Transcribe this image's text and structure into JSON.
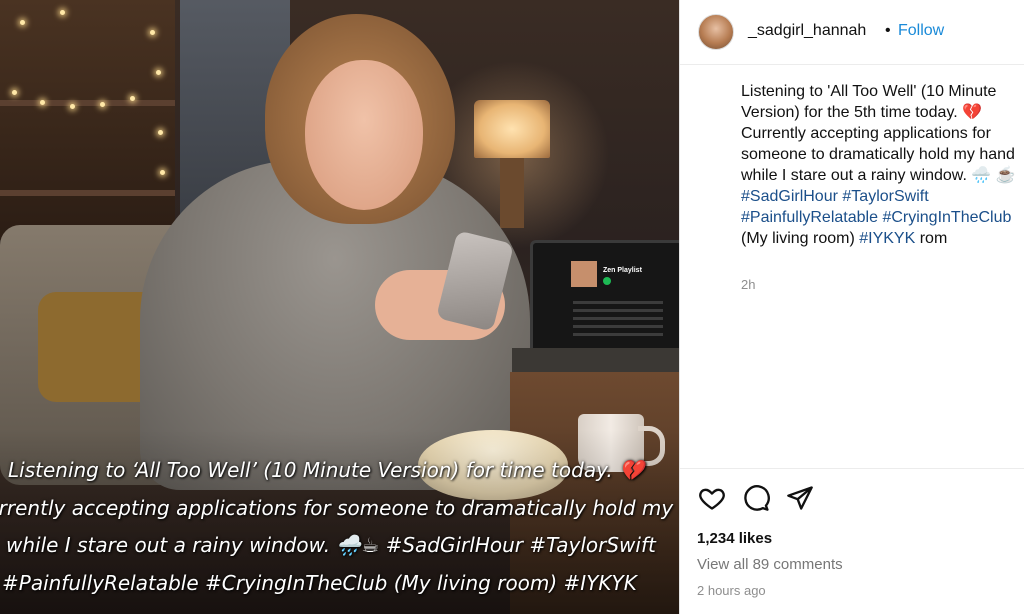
{
  "photo": {
    "laptop_playlist_title": "Zen Playlist",
    "overlay_lines": [
      "Listening to ‘All Too Well’ (10 Minute Version) for time today. 💔",
      "urrently accepting applications for someone to dramatically hold my hand",
      "while I stare out a rainy window. 🌧️☕ #SadGirlHour #TaylorSwift",
      "#PainfullyRelatable #CryingInTheClub (My living room) #IYKYK"
    ]
  },
  "header": {
    "username": "_sadgirl_hannah",
    "separator": "•",
    "follow_label": "Follow"
  },
  "caption": {
    "text_1": "Listening to 'All Too Well' (10 Minute Version) for the 5th time today. 💔 Currently accepting applications for someone to dramatically hold my hand while I stare out a rainy window. 🌧️ ☕ ",
    "tag_1": "#SadGirlHour",
    "tag_2": "#TaylorSwift",
    "tag_3": "#PainfullyRelatable",
    "tag_4": "#CryingInTheClub",
    "text_2": " (My living room) ",
    "tag_5": "#IYKYK",
    "text_3": " rom",
    "time": "2h"
  },
  "actions": {
    "icons": [
      "heart-icon",
      "comment-icon",
      "share-icon"
    ]
  },
  "stats": {
    "likes": "1,234 likes",
    "comments": "View all 89 comments",
    "posted": "2 hours ago"
  },
  "colors": {
    "link": "#1a8ad8",
    "hashtag": "#1b4f8a",
    "muted": "#8e8e8e"
  }
}
